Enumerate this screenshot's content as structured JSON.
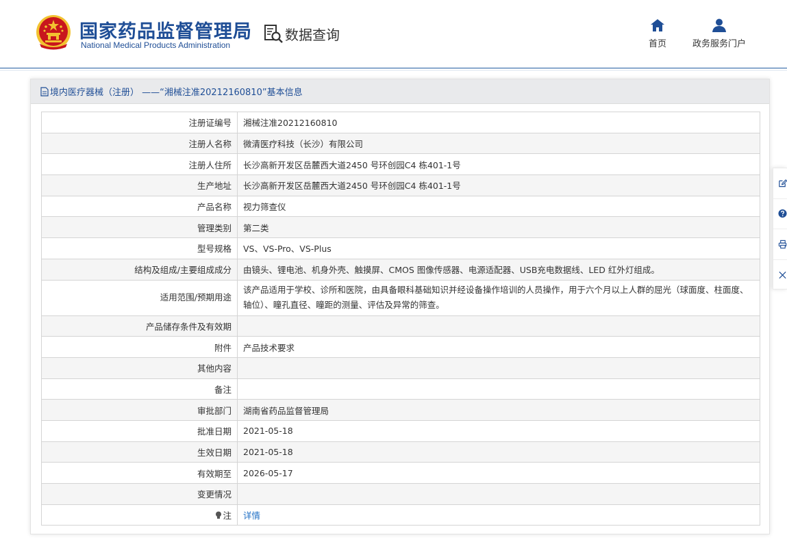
{
  "header": {
    "org_name_cn": "国家药品监督管理局",
    "org_name_en": "National Medical Products Administration",
    "section_title": "数据查询",
    "nav": [
      {
        "label": "首页",
        "icon": "home-icon"
      },
      {
        "label": "政务服务门户",
        "icon": "user-icon"
      }
    ]
  },
  "panel": {
    "title": "境内医疗器械（注册） ——“湘械注准20212160810”基本信息"
  },
  "fields": [
    {
      "key": "注册证编号",
      "value": "湘械注准20212160810"
    },
    {
      "key": "注册人名称",
      "value": "微清医疗科技（长沙）有限公司"
    },
    {
      "key": "注册人住所",
      "value": "长沙高新开发区岳麓西大道2450 号环创园C4 栋401-1号"
    },
    {
      "key": "生产地址",
      "value": "长沙高新开发区岳麓西大道2450 号环创园C4 栋401-1号"
    },
    {
      "key": "产品名称",
      "value": "视力筛查仪"
    },
    {
      "key": "管理类别",
      "value": "第二类"
    },
    {
      "key": "型号规格",
      "value": "VS、VS-Pro、VS-Plus"
    },
    {
      "key": "结构及组成/主要组成成分",
      "value": "由镜头、锂电池、机身外壳、触摸屏、CMOS 图像传感器、电源适配器、USB充电数据线、LED 红外灯组成。"
    },
    {
      "key": "适用范围/预期用途",
      "value": "该产品适用于学校、诊所和医院，由具备眼科基础知识并经设备操作培训的人员操作，用于六个月以上人群的屈光（球面度、柱面度、轴位）、瞳孔直径、瞳距的测量、评估及异常的筛查。"
    },
    {
      "key": "产品储存条件及有效期",
      "value": ""
    },
    {
      "key": "附件",
      "value": "产品技术要求"
    },
    {
      "key": "其他内容",
      "value": ""
    },
    {
      "key": "备注",
      "value": ""
    },
    {
      "key": "审批部门",
      "value": "湖南省药品监督管理局"
    },
    {
      "key": "批准日期",
      "value": "2021-05-18"
    },
    {
      "key": "生效日期",
      "value": "2021-05-18"
    },
    {
      "key": "有效期至",
      "value": "2026-05-17"
    },
    {
      "key": "变更情况",
      "value": ""
    }
  ],
  "note_row": {
    "key": "注",
    "link": "详情",
    "icon": "lightbulb-icon"
  },
  "side_tools": [
    {
      "icon": "edit-icon"
    },
    {
      "icon": "help-icon"
    },
    {
      "icon": "print-icon"
    },
    {
      "icon": "close-icon"
    }
  ],
  "colors": {
    "brand": "#1f4e96",
    "link": "#1f6fc5",
    "emblem_red": "#c8161d",
    "emblem_gold": "#f2c230"
  }
}
